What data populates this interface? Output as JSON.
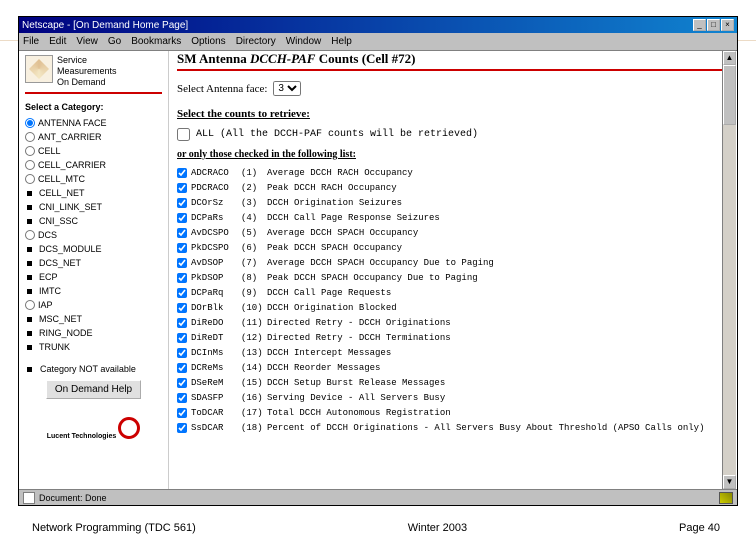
{
  "window": {
    "title": "Netscape - [On Demand Home Page]",
    "menu": [
      "File",
      "Edit",
      "View",
      "Go",
      "Bookmarks",
      "Options",
      "Directory",
      "Window",
      "Help"
    ]
  },
  "sidebar": {
    "brand": [
      "Service",
      "Measurements",
      "On Demand"
    ],
    "categoryLabel": "Select a Category:",
    "categories": [
      {
        "kind": "radio",
        "label": "ANTENNA FACE",
        "checked": true
      },
      {
        "kind": "radio",
        "label": "ANT_CARRIER",
        "checked": false
      },
      {
        "kind": "radio",
        "label": "CELL",
        "checked": false
      },
      {
        "kind": "radio",
        "label": "CELL_CARRIER",
        "checked": false
      },
      {
        "kind": "radio",
        "label": "CELL_MTC",
        "checked": false
      },
      {
        "kind": "bullet",
        "label": "CELL_NET"
      },
      {
        "kind": "bullet",
        "label": "CNI_LINK_SET"
      },
      {
        "kind": "bullet",
        "label": "CNI_SSC"
      },
      {
        "kind": "radio",
        "label": "DCS",
        "checked": false
      },
      {
        "kind": "bullet",
        "label": "DCS_MODULE"
      },
      {
        "kind": "bullet",
        "label": "DCS_NET"
      },
      {
        "kind": "bullet",
        "label": "ECP"
      },
      {
        "kind": "bullet",
        "label": "IMTC"
      },
      {
        "kind": "radio",
        "label": "IAP",
        "checked": false
      },
      {
        "kind": "bullet",
        "label": "MSC_NET"
      },
      {
        "kind": "bullet",
        "label": "RING_NODE"
      },
      {
        "kind": "bullet",
        "label": "TRUNK"
      }
    ],
    "notAvail": "Category NOT available",
    "helpBtn": "On Demand Help",
    "lucent": "Lucent Technologies"
  },
  "main": {
    "titlePrefix": "SM Antenna ",
    "titleItalic": "DCCH-PAF",
    "titleSuffix": " Counts (Cell #72)",
    "selectAntenna": "Select Antenna face:",
    "antennaValue": "3",
    "selectCounts": "Select the counts to retrieve:",
    "allLabel": "ALL (All the DCCH-PAF counts will be retrieved)",
    "orOnly": "or only those checked in the following list:",
    "counts": [
      {
        "c": "ADCRACO",
        "n": "(1)",
        "d": "Average DCCH RACH Occupancy"
      },
      {
        "c": "PDCRACO",
        "n": "(2)",
        "d": "Peak DCCH RACH Occupancy"
      },
      {
        "c": "DCOrSz",
        "n": "(3)",
        "d": "DCCH Origination Seizures"
      },
      {
        "c": "DCPaRs",
        "n": "(4)",
        "d": "DCCH Call Page Response Seizures"
      },
      {
        "c": "AvDCSPO",
        "n": "(5)",
        "d": "Average DCCH SPACH Occupancy"
      },
      {
        "c": "PkDCSPO",
        "n": "(6)",
        "d": "Peak DCCH SPACH Occupancy"
      },
      {
        "c": "AvDSOP",
        "n": "(7)",
        "d": "Average DCCH SPACH Occupancy Due to Paging"
      },
      {
        "c": "PkDSOP",
        "n": "(8)",
        "d": "Peak DCCH SPACH Occupancy Due to Paging"
      },
      {
        "c": "DCPaRq",
        "n": "(9)",
        "d": "DCCH Call Page Requests"
      },
      {
        "c": "DOrBlk",
        "n": "(10)",
        "d": "DCCH Origination Blocked"
      },
      {
        "c": "DiReDO",
        "n": "(11)",
        "d": "Directed Retry - DCCH Originations"
      },
      {
        "c": "DiReDT",
        "n": "(12)",
        "d": "Directed Retry - DCCH Terminations"
      },
      {
        "c": "DCInMs",
        "n": "(13)",
        "d": "DCCH Intercept Messages"
      },
      {
        "c": "DCReMs",
        "n": "(14)",
        "d": "DCCH Reorder Messages"
      },
      {
        "c": "DSeReM",
        "n": "(15)",
        "d": "DCCH Setup Burst Release Messages"
      },
      {
        "c": "SDASFP",
        "n": "(16)",
        "d": "Serving Device - All Servers Busy"
      },
      {
        "c": "ToDCAR",
        "n": "(17)",
        "d": "Total DCCH Autonomous Registration"
      },
      {
        "c": "SsDCAR",
        "n": "(18)",
        "d": "Percent of DCCH Originations - All Servers Busy About Threshold (APSO Calls only)"
      }
    ]
  },
  "status": {
    "text": "Document: Done"
  },
  "footer": {
    "left": "Network Programming (TDC 561)",
    "center": "Winter  2003",
    "right": "Page 40"
  }
}
